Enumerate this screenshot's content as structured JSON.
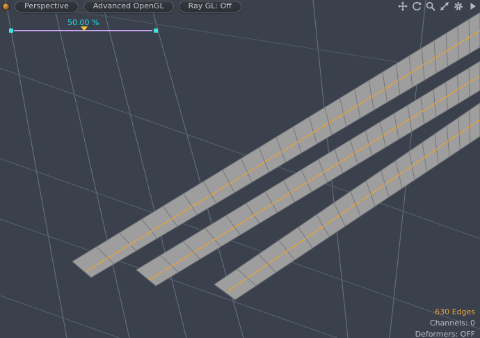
{
  "viewport": {
    "toolbar": {
      "camera_button": "Perspective",
      "shading_button": "Advanced OpenGL",
      "raygl_button": "Ray GL: Off"
    },
    "slider": {
      "value_label": "50.00 %"
    },
    "nav_icons": {
      "pan": "pan-icon",
      "orbit": "orbit-icon",
      "zoom": "zoom-icon",
      "maximize": "maximize-icon",
      "settings": "settings-gear-icon",
      "flyout": "flyout-arrow-icon"
    },
    "status": {
      "edges": "630 Edges",
      "channels": "Channels: 0",
      "deformers": "Deformers: OFF"
    }
  },
  "colors": {
    "background": "#3b414c",
    "grid_vertical": "#6b7482",
    "grid_diagonal": "#5a6370",
    "grid_faint": "#515a66",
    "strip_fill": "#9e9e9e",
    "strip_outline": "#707276",
    "strip_wire": "#76767a",
    "selection_orange": "#f3a32b",
    "slider_violet": "#c7a2f5",
    "slider_cyan": "#3be4e6",
    "marker_yellow": "#e9c63c",
    "label_cyan": "#27dde6",
    "status_orange": "#e8a43a",
    "status_gray": "#b9bfc6",
    "icon_gray": "#b6bac0"
  }
}
